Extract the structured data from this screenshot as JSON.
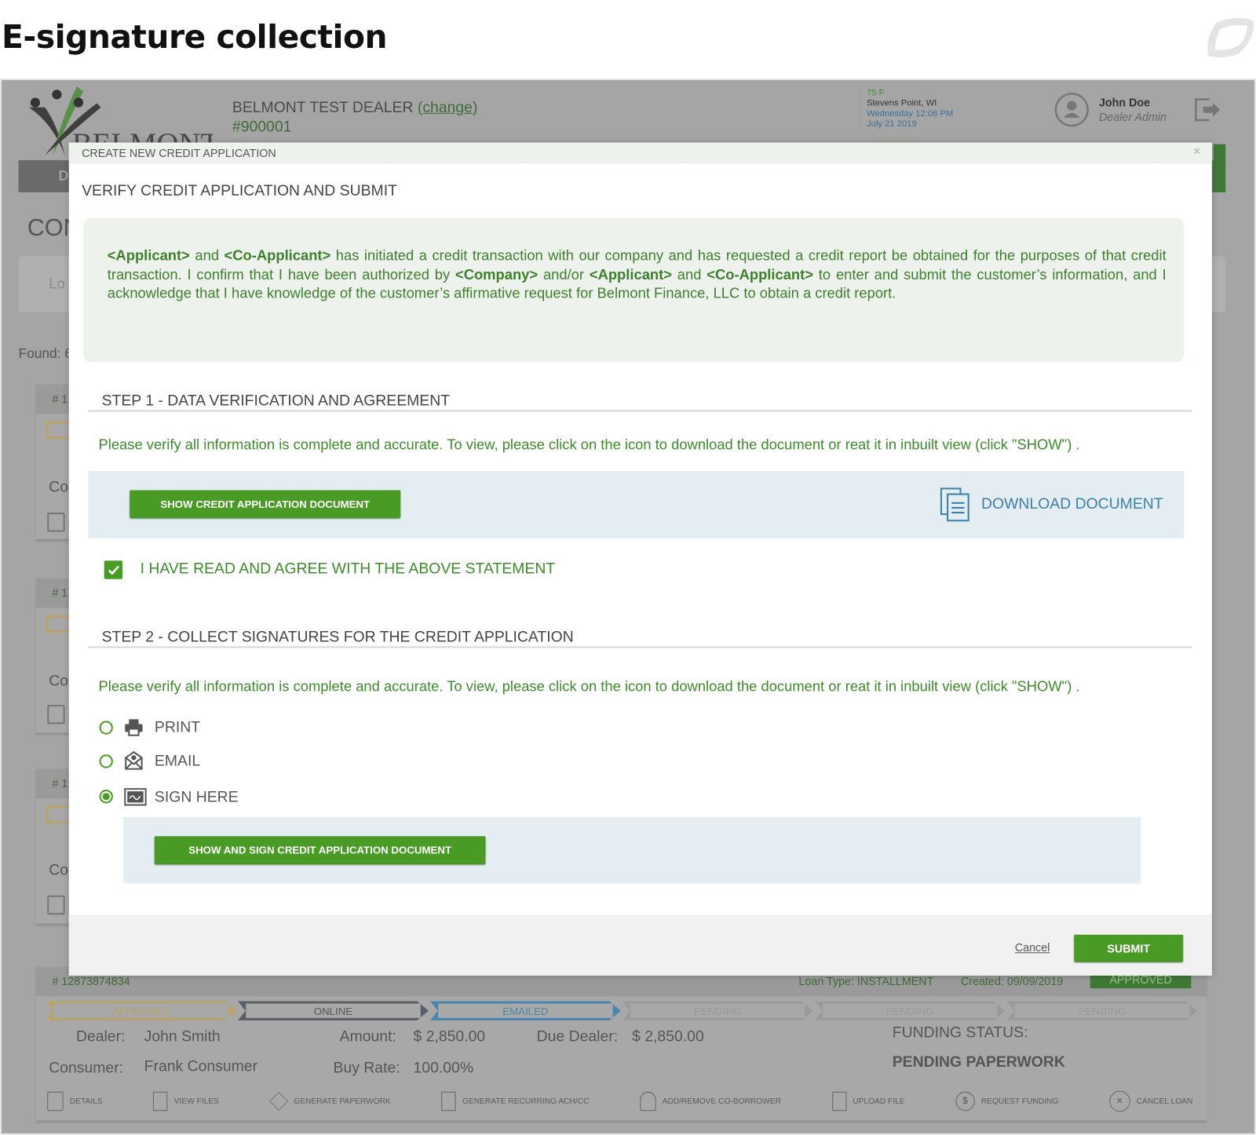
{
  "page_title": "E-signature collection",
  "colors": {
    "accent_green": "#4a9a26",
    "text_green": "#3d7f2c",
    "link_blue": "#3d7fa8",
    "overlay_gray": "#a6a5a6"
  },
  "header": {
    "logo_text": "BELMONT",
    "dealer_name": "BELMONT TEST DEALER",
    "change_link": "(change)",
    "dealer_number": "#900001",
    "weather": {
      "temp": "75 F",
      "location": "Stevens Point, WI",
      "day_time": "Wednesday 12:06 PM",
      "date": "July 21 2019"
    },
    "user": {
      "name": "John Doe",
      "role": "Dealer Admin"
    }
  },
  "background": {
    "nav_first_letter": "D",
    "heading_partial": "CON",
    "search_partial": "Lo",
    "found_partial": "Found: 6",
    "card_ids_partial": [
      "# 1",
      "# 1",
      "# 1"
    ],
    "card_label_partial": "Co",
    "bottom_card": {
      "id": "# 12873874834",
      "loan_type": "Loan Type: INSTALLMENT",
      "created": "Created: 09/09/2019",
      "status": "APPROVED",
      "stages": [
        "APPROVED",
        "ONLINE",
        "EMAILED",
        "PENDING",
        "PENDING",
        "PENDING"
      ],
      "dealer_label": "Dealer:",
      "dealer_value": "John Smith",
      "consumer_label": "Consumer:",
      "consumer_value": "Frank Consumer",
      "amount_label": "Amount:",
      "amount_value": "$ 2,850.00",
      "due_label": "Due Dealer:",
      "due_value": "$ 2,850.00",
      "buyrate_label": "Buy Rate:",
      "buyrate_value": "100.00%",
      "funding_label": "FUNDING STATUS:",
      "funding_value": "PENDING PAPERWORK",
      "actions": [
        "DETAILS",
        "VIEW FILES",
        "GENERATE PAPERWORK",
        "GENERATE RECURRING ACH/CC",
        "ADD/REMOVE CO-BORROWER",
        "UPLOAD FILE",
        "REQUEST FUNDING",
        "CANCEL LOAN"
      ]
    }
  },
  "modal": {
    "title": "CREATE NEW CREDIT APPLICATION",
    "close": "×",
    "heading": "VERIFY CREDIT APPLICATION AND SUBMIT",
    "agreement": {
      "applicant": "<Applicant>",
      "and1": " and ",
      "co_applicant": "<Co-Applicant>",
      "part1": " has initiated a credit transaction with our company and has requested a credit report be obtained for the purposes of that credit transaction.  I confirm that I have been authorized by ",
      "company": "<Company>",
      "andor": " and/or ",
      "applicant2": "<Applicant>",
      "and2": " and ",
      "co_applicant2": "<Co-Applicant>",
      "part2": " to enter and submit the customer’s information, and I acknowledge that I have knowledge of the customer’s affirmative request for Belmont Finance, LLC to obtain a credit report."
    },
    "step1": {
      "title": "STEP 1 - DATA VERIFICATION AND AGREEMENT",
      "instructions": "Please verify all information is complete and accurate.  To view, please click on the icon to download the document or reat it in inbuilt view (click \"SHOW\") .",
      "show_button": "SHOW CREDIT APPLICATION DOCUMENT",
      "download_label": "DOWNLOAD DOCUMENT",
      "agree_checked": true,
      "agree_label": "I HAVE READ AND AGREE WITH THE ABOVE STATEMENT"
    },
    "step2": {
      "title": "STEP 2 - COLLECT SIGNATURES FOR THE CREDIT APPLICATION",
      "instructions": "Please verify all information is complete and accurate.  To view, please click on the icon to download the document or reat it in inbuilt view (click \"SHOW\") .",
      "options": [
        {
          "label": "PRINT",
          "icon": "printer-icon",
          "selected": false
        },
        {
          "label": "EMAIL",
          "icon": "email-icon",
          "selected": false
        },
        {
          "label": "SIGN HERE",
          "icon": "signature-icon",
          "selected": true
        }
      ],
      "sign_button": "SHOW AND SIGN CREDIT APPLICATION DOCUMENT"
    },
    "footer": {
      "cancel": "Cancel",
      "submit": "SUBMIT"
    }
  }
}
